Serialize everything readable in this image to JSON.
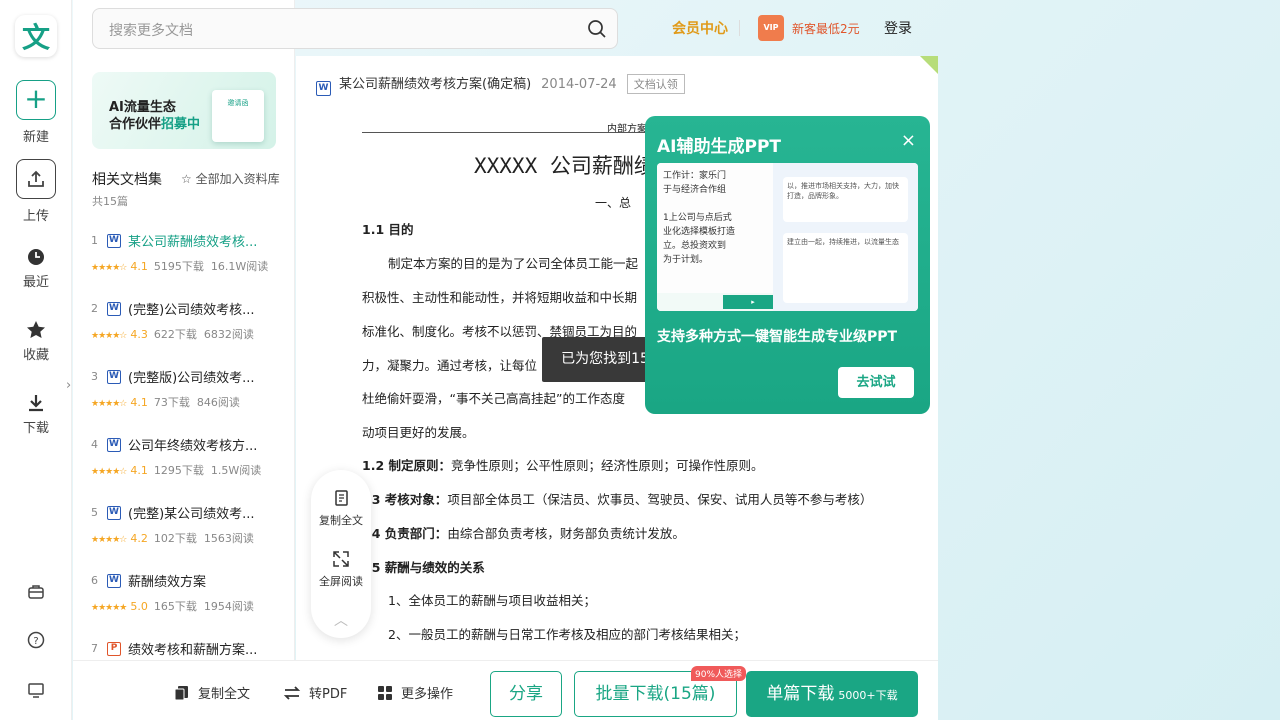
{
  "logo": {
    "glyph": "文"
  },
  "rail": {
    "new": "新建",
    "upload": "上传",
    "recent": "最近",
    "favorites": "收藏",
    "download": "下载"
  },
  "search": {
    "placeholder": "搜索更多文档"
  },
  "header": {
    "vip_center": "会员中心",
    "vip_badge": "VIP",
    "new_user": "新客最低2元",
    "login": "登录"
  },
  "banner": {
    "line1": "AI流量生态",
    "line2_prefix": "合作伙伴",
    "line2_highlight": "招募中",
    "card_text": "邀请函"
  },
  "related": {
    "title": "相关文档集",
    "add_all": "全部加入资料库",
    "count": "共15篇",
    "items": [
      {
        "num": "1",
        "type": "W",
        "title": "某公司薪酬绩效考核...",
        "rating": "4.1",
        "downloads": "5195下载",
        "reads": "16.1W阅读"
      },
      {
        "num": "2",
        "type": "W",
        "title": "(完整)公司绩效考核...",
        "rating": "4.3",
        "downloads": "622下载",
        "reads": "6832阅读"
      },
      {
        "num": "3",
        "type": "W",
        "title": "(完整版)公司绩效考...",
        "rating": "4.1",
        "downloads": "73下载",
        "reads": "846阅读"
      },
      {
        "num": "4",
        "type": "W",
        "title": "公司年终绩效考核方...",
        "rating": "4.1",
        "downloads": "1295下载",
        "reads": "1.5W阅读"
      },
      {
        "num": "5",
        "type": "W",
        "title": "(完整)某公司绩效考...",
        "rating": "4.2",
        "downloads": "102下载",
        "reads": "1563阅读"
      },
      {
        "num": "6",
        "type": "W",
        "title": "薪酬绩效方案",
        "rating": "5.0",
        "downloads": "165下载",
        "reads": "1954阅读"
      },
      {
        "num": "7",
        "type": "P",
        "title": "绩效考核和薪酬方案...",
        "rating": "",
        "downloads": "",
        "reads": ""
      }
    ]
  },
  "doc": {
    "type": "W",
    "title": "某公司薪酬绩效考核方案(确定稿)",
    "date": "2014-07-24",
    "badge": "文档认领",
    "header_text": "内部方案",
    "main_title": "XXXXX 公司薪酬绩效考核方案",
    "section1": "一、总",
    "lines": {
      "h11": "1.1 目的",
      "p1": "制定本方案的目的是为了公司全体员工能一起",
      "p2": "积极性、主动性和能动性，并将短期收益和中长期",
      "p3": "标准化、制度化。考核不以惩罚、禁锢员工为目的",
      "p4": "力，凝聚力。通过考核，让每位",
      "p5": "杜绝偷奸耍滑，“事不关己高高挂起”的工作态度",
      "p6": "动项目更好的发展。",
      "h12_label": "1.2 制定原则：",
      "h12_text": "竞争性原则；公平性原则；经济性原则；可操作性原则。",
      "h13_label": ".3 考核对象：",
      "h13_text": "项目部全体员工（保洁员、炊事员、驾驶员、保安、试用人员等不参与考核）",
      "h14_label": ".4 负责部门：",
      "h14_text": "由综合部负责考核，财务部负责统计发放。",
      "h15": ".5 薪酬与绩效的关系",
      "l1": "1、全体员工的薪酬与项目收益相关；",
      "l2": "2、一般员工的薪酬与日常工作考核及相应的部门考核结果相关；"
    }
  },
  "float_tools": {
    "copy": "复制全文",
    "fullscreen": "全屏阅读"
  },
  "toast": "已为您找到15篇相关文档",
  "ai_popup": {
    "title": "AI辅助生成PPT",
    "close": "×",
    "description": "支持多种方式一键智能生成专业级PPT",
    "try_button": "去试试",
    "preview_left": [
      "工作计：家乐门",
      "于与经济合作组",
      "",
      "1上公司与点后式",
      "业化选择模板打造",
      "立。总投资欢到",
      "为于计划。"
    ],
    "preview_right_a": "以，推进市场相关支持，大力，加快打造，品牌形象。",
    "preview_right_b": "建立由一起，持续推进，以流量生态"
  },
  "bottom": {
    "copy_all": "复制全文",
    "to_pdf": "转PDF",
    "more": "更多操作",
    "share": "分享",
    "batch": "批量下载(15篇)",
    "badge": "90%人选择",
    "single": "单篇下载",
    "single_count": "5000+下载"
  },
  "colors": {
    "brand": "#1aa684",
    "vip": "#e09a1a",
    "star": "#f5a623",
    "hot": "#e0552b"
  },
  "icons": [
    "plus-icon",
    "upload-icon",
    "clock-icon",
    "star-icon",
    "download-icon",
    "toolbox-icon",
    "help-icon",
    "monitor-icon",
    "search-icon",
    "chevron-right-icon",
    "copy-icon",
    "fullscreen-icon",
    "arrow-up-icon",
    "swap-icon",
    "grid-icon"
  ]
}
